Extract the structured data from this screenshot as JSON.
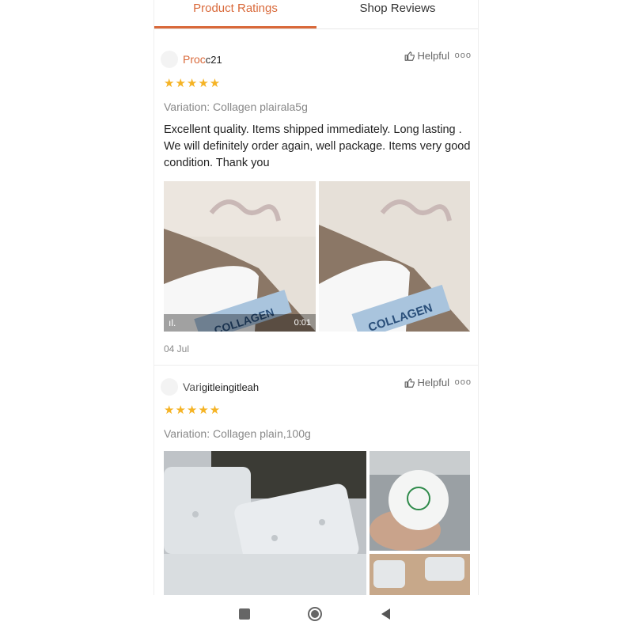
{
  "tabs": [
    {
      "label": "Product Ratings",
      "active": true
    },
    {
      "label": "Shop Reviews",
      "active": false
    }
  ],
  "colors": {
    "accent": "#d9693a",
    "star": "#f5b324"
  },
  "reviews": [
    {
      "ghost_text": "Proc",
      "name": "c21",
      "helpful_label": "Helpful",
      "stars": "★★★★★",
      "variation": "Variation: Collagen plairala5g",
      "text": "Excellent quality. Items shipped immediately. Long lasting . We will definitely order again, well package. Items very good condition. Thank you",
      "video_duration": "0:01",
      "date": "04 Jul"
    },
    {
      "ghost_text": "Vari",
      "name": "gitleingitleah",
      "helpful_label": "Helpful",
      "stars": "★★★★★",
      "variation": "Variation: Collagen plain,100g"
    }
  ],
  "icons": [
    "thumbs-up-icon",
    "more-icon",
    "video-icon",
    "recents-icon",
    "home-icon",
    "back-icon"
  ]
}
